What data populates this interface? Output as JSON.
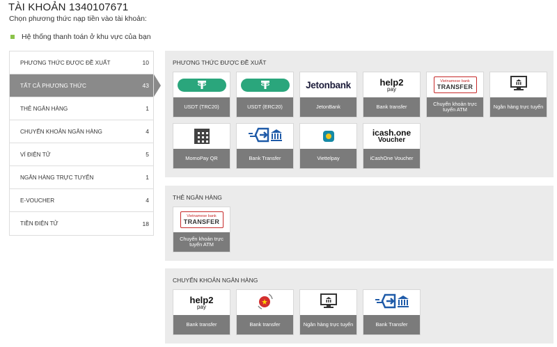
{
  "account": {
    "title": "TÀI KHOẢN 1340107671",
    "subtitle": "Chọn phương thức nạp tiền vào tài khoản:",
    "notice": "Hệ thống thanh toán ở khu vực của bạn"
  },
  "sidebar": {
    "items": [
      {
        "label": "PHƯƠNG THỨC ĐƯỢC ĐỀ XUẤT",
        "count": "10",
        "active": false
      },
      {
        "label": "TẤT CẢ PHƯƠNG THỨC",
        "count": "43",
        "active": true
      },
      {
        "label": "THẺ NGÂN HÀNG",
        "count": "1",
        "active": false
      },
      {
        "label": "CHUYỂN KHOẢN NGÂN HÀNG",
        "count": "4",
        "active": false
      },
      {
        "label": "VÍ ĐIỆN TỬ",
        "count": "5",
        "active": false
      },
      {
        "label": "NGÂN HÀNG TRỰC TUYẾN",
        "count": "1",
        "active": false
      },
      {
        "label": "E-VOUCHER",
        "count": "4",
        "active": false
      },
      {
        "label": "TIỀN ĐIỆN TỬ",
        "count": "18",
        "active": false
      }
    ]
  },
  "sections": [
    {
      "title": "PHƯƠNG THỨC ĐƯỢC ĐỀ XUẤT",
      "cards": [
        {
          "caption": "USDT (TRC20)",
          "icon": "tether-icon"
        },
        {
          "caption": "USDT (ERC20)",
          "icon": "tether-icon"
        },
        {
          "caption": "JetonBank",
          "icon": "jetonbank-logo",
          "logo_text": "Jetonbank"
        },
        {
          "caption": "Bank transfer",
          "icon": "help2pay-logo",
          "logo_text": "help2",
          "logo_sub": "pay"
        },
        {
          "caption": "Chuyển khoản trực tuyến ATM",
          "icon": "vietnamese-bank-transfer-logo",
          "logo_line1": "Vietnamese bank",
          "logo_line2": "TRANSFER"
        },
        {
          "caption": "Ngân hàng trực tuyến",
          "icon": "online-bank-monitor-icon"
        },
        {
          "caption": "MomoPay QR",
          "icon": "qr-code-icon"
        },
        {
          "caption": "Bank Transfer",
          "icon": "bank-transfer-arrow-icon"
        },
        {
          "caption": "Viettelpay",
          "icon": "viettelpay-icon"
        },
        {
          "caption": "iCashOne Voucher",
          "icon": "icashone-logo",
          "logo_text": "icash.one",
          "logo_sub": "Voucher"
        }
      ]
    },
    {
      "title": "THẺ NGÂN HÀNG",
      "cards": [
        {
          "caption": "Chuyển khoản trực tuyến ATM",
          "icon": "vietnamese-bank-transfer-logo",
          "logo_line1": "Vietnamese bank",
          "logo_line2": "TRANSFER"
        }
      ]
    },
    {
      "title": "CHUYỂN KHOẢN NGÂN HÀNG",
      "cards": [
        {
          "caption": "Bank transfer",
          "icon": "help2pay-logo",
          "logo_text": "help2",
          "logo_sub": "pay"
        },
        {
          "caption": "Bank transfer",
          "icon": "vietnam-flag-transfer-icon"
        },
        {
          "caption": "Ngân hàng trực tuyến",
          "icon": "online-bank-monitor-icon"
        },
        {
          "caption": "Bank Transfer",
          "icon": "bank-transfer-arrow-icon"
        }
      ]
    }
  ],
  "colors": {
    "tether_green": "#2aa67c",
    "active_sidebar": "#8a8a8a",
    "caption_bg": "#7b7b7b",
    "section_bg": "#ebebeb",
    "notice_bullet": "#8bc34a"
  }
}
